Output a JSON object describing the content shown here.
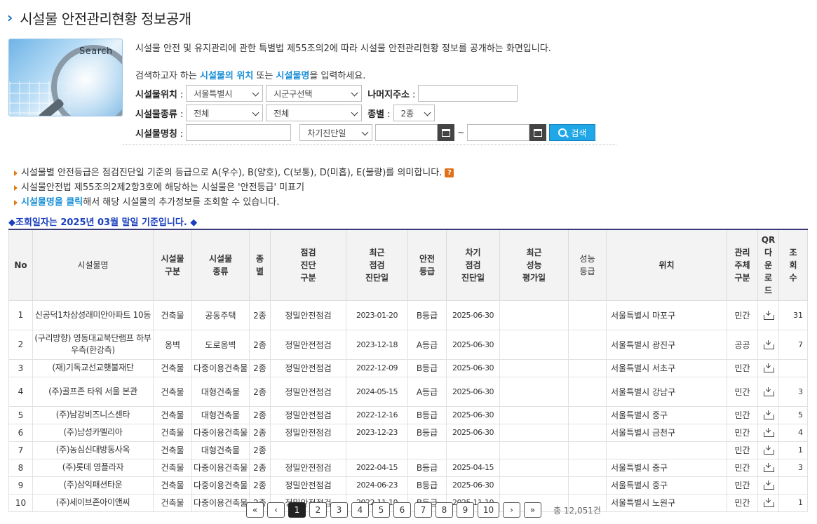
{
  "page": {
    "title": "시설물 안전관리현황 정보공개",
    "search_image_word": "Search",
    "description": "시설물 안전 및 유지관리에 관한 특별법 제55조의2에 따라 시설물 안전관리현황 정보를 공개하는 화면입니다.",
    "hint_pre": "검색하고자 하는 ",
    "hint_hl1": "시설물의 위치",
    "hint_mid": " 또는 ",
    "hint_hl2": "시설물명",
    "hint_post": "을 입력하세요."
  },
  "form": {
    "location_label": "시설물위치",
    "sido_value": "서울특별시",
    "sigungu_value": "시군구선택",
    "rest_address_label": "나머지주소",
    "rest_address_value": "",
    "type_label": "시설물종류",
    "type1_value": "전체",
    "type2_value": "전체",
    "class_label": "종별",
    "class_value": "2종",
    "name_label": "시설물명칭",
    "name_value": "",
    "date_type_value": "차기진단일",
    "date_from": "",
    "tilde": "~",
    "date_to": "",
    "search_button": "검색",
    "colon": ":"
  },
  "notes": {
    "n1": "시설물별 안전등급은 점검진단일 기준의 등급으로 A(우수), B(양호), C(보통), D(미흡), E(불량)를 의미합니다.",
    "n1_badge": "?",
    "n2": "시설물안전법 제55조의2제2항3호에 해당하는 시설물은 '안전등급' 미표기",
    "n3_hl": "시설물명을 클릭",
    "n3_rest": "해서 해당 시설물의 추가정보를 조회할 수 있습니다."
  },
  "base_date": "◆조회일자는 2025년 03월 말일 기준입니다. ◆",
  "table": {
    "headers": [
      "No",
      "시설물명",
      "시설물\n구분",
      "시설물\n종류",
      "종\n별",
      "점검\n진단\n구분",
      "최근\n점검\n진단일",
      "안전\n등급",
      "차기\n점검\n진단일",
      "최근\n성능\n평가일",
      "성능\n등급",
      "위치",
      "관리\n주체\n구분",
      "QR\n다\n운\n로\n드",
      "조\n회\n수"
    ],
    "rows": [
      {
        "no": "1",
        "name": "신공덕1차삼성래미안아파트 10동",
        "kind": "건축물",
        "type": "공동주택",
        "cls": "2종",
        "insp": "정밀안전점검",
        "last": "2023-01-20",
        "grade": "B등급",
        "next": "2025-06-30",
        "perf": "",
        "pgrade": "",
        "loc": "서울특별시 마포구",
        "owner": "민간",
        "views": "31"
      },
      {
        "no": "2",
        "name": "(구리방향) 영동대교북단램프 하부우측(한강측)",
        "kind": "옹벽",
        "type": "도로옹벽",
        "cls": "2종",
        "insp": "정밀안전점검",
        "last": "2023-12-18",
        "grade": "A등급",
        "next": "2025-06-30",
        "perf": "",
        "pgrade": "",
        "loc": "서울특별시 광진구",
        "owner": "공공",
        "views": "7"
      },
      {
        "no": "3",
        "name": "(재)기독교선교횃불재단",
        "kind": "건축물",
        "type": "다중이용건축물",
        "cls": "2종",
        "insp": "정밀안전점검",
        "last": "2022-12-09",
        "grade": "B등급",
        "next": "2025-06-30",
        "perf": "",
        "pgrade": "",
        "loc": "서울특별시 서초구",
        "owner": "민간",
        "views": ""
      },
      {
        "no": "4",
        "name": "(주)골프존 타워 서울 본관",
        "kind": "건축물",
        "type": "대형건축물",
        "cls": "2종",
        "insp": "정밀안전점검",
        "last": "2024-05-15",
        "grade": "A등급",
        "next": "2025-06-30",
        "perf": "",
        "pgrade": "",
        "loc": "서울특별시 강남구",
        "owner": "민간",
        "views": "3"
      },
      {
        "no": "5",
        "name": "(주)남강비즈니스센타",
        "kind": "건축물",
        "type": "대형건축물",
        "cls": "2종",
        "insp": "정밀안전점검",
        "last": "2022-12-16",
        "grade": "B등급",
        "next": "2025-06-30",
        "perf": "",
        "pgrade": "",
        "loc": "서울특별시 중구",
        "owner": "민간",
        "views": "5"
      },
      {
        "no": "6",
        "name": "(주)남성카멜리아",
        "kind": "건축물",
        "type": "다중이용건축물",
        "cls": "2종",
        "insp": "정밀안전점검",
        "last": "2023-12-23",
        "grade": "B등급",
        "next": "2025-06-30",
        "perf": "",
        "pgrade": "",
        "loc": "서울특별시 금천구",
        "owner": "민간",
        "views": "4"
      },
      {
        "no": "7",
        "name": "(주)농심신대방동사옥",
        "kind": "건축물",
        "type": "대형건축물",
        "cls": "2종",
        "insp": "",
        "last": "",
        "grade": "",
        "next": "",
        "perf": "",
        "pgrade": "",
        "loc": "",
        "owner": "민간",
        "views": "1"
      },
      {
        "no": "8",
        "name": "(주)롯데 영플라자",
        "kind": "건축물",
        "type": "다중이용건축물",
        "cls": "2종",
        "insp": "정밀안전점검",
        "last": "2022-04-15",
        "grade": "B등급",
        "next": "2025-04-15",
        "perf": "",
        "pgrade": "",
        "loc": "서울특별시 중구",
        "owner": "민간",
        "views": "3"
      },
      {
        "no": "9",
        "name": "(주)삼익패션타운",
        "kind": "건축물",
        "type": "다중이용건축물",
        "cls": "2종",
        "insp": "정밀안전점검",
        "last": "2024-06-23",
        "grade": "B등급",
        "next": "2025-06-30",
        "perf": "",
        "pgrade": "",
        "loc": "서울특별시 중구",
        "owner": "민간",
        "views": ""
      },
      {
        "no": "10",
        "name": "(주)세이브존아이앤씨",
        "kind": "건축물",
        "type": "다중이용건축물",
        "cls": "2종",
        "insp": "정밀안전점검",
        "last": "2022-11-10",
        "grade": "B등급",
        "next": "2025-11-10",
        "perf": "",
        "pgrade": "",
        "loc": "서울특별시 노원구",
        "owner": "민간",
        "views": "1"
      }
    ]
  },
  "pager": {
    "first": "«",
    "prev": "‹",
    "pages": [
      "1",
      "2",
      "3",
      "4",
      "5",
      "6",
      "7",
      "8",
      "9",
      "10"
    ],
    "current": "1",
    "next": "›",
    "last": "»",
    "total": "총 12,051건"
  }
}
